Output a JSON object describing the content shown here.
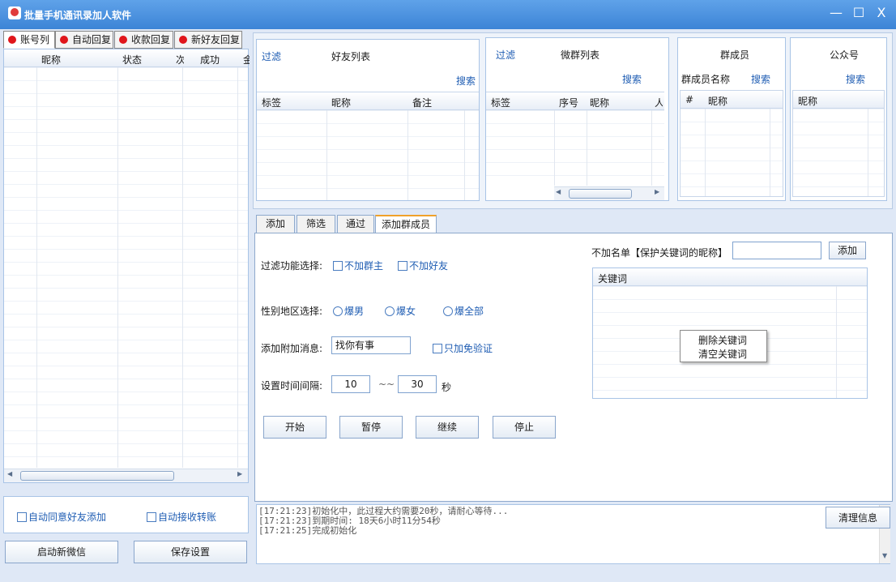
{
  "window": {
    "title": "批量手机通讯录加人软件",
    "controls": [
      "—",
      "☐",
      "X"
    ]
  },
  "left_tabs": [
    {
      "label": "账号列"
    },
    {
      "label": "自动回复"
    },
    {
      "label": "收款回复"
    },
    {
      "label": "新好友回复"
    }
  ],
  "account_table": {
    "columns": [
      "昵称",
      "状态",
      "次",
      "成功",
      "金"
    ]
  },
  "left_options": {
    "auto_accept_friend": "自动同意好友添加",
    "auto_receive_transfer": "自动接收转账"
  },
  "left_buttons": {
    "start_wechat": "启动新微信",
    "save_settings": "保存设置"
  },
  "friend_panel": {
    "filter": "过滤",
    "title": "好友列表",
    "search": "搜索",
    "columns": [
      "标签",
      "昵称",
      "备注"
    ]
  },
  "group_panel": {
    "filter": "过滤",
    "title": "微群列表",
    "search": "搜索",
    "columns": [
      "标签",
      "序号",
      "昵称",
      "人"
    ]
  },
  "member_panel": {
    "title": "群成员",
    "name_label": "群成员名称",
    "search": "搜索",
    "columns": [
      "#",
      "昵称"
    ]
  },
  "official_panel": {
    "title": "公众号",
    "search": "搜索",
    "columns": [
      "昵称"
    ]
  },
  "sub_tabs": [
    {
      "label": "添加"
    },
    {
      "label": "筛选"
    },
    {
      "label": "通过"
    },
    {
      "label": "添加群成员"
    }
  ],
  "form": {
    "filter_label": "过滤功能选择:",
    "no_group_owner": "不加群主",
    "no_friend": "不加好友",
    "gender_label": "性别地区选择:",
    "male": "爆男",
    "female": "爆女",
    "all": "爆全部",
    "message_label": "添加附加消息:",
    "message_value": "找你有事",
    "no_verify": "只加免验证",
    "interval_label": "设置时间间隔:",
    "interval_min": "10",
    "interval_sep": "~~",
    "interval_max": "30",
    "interval_unit": "秒"
  },
  "blacklist": {
    "label": "不加名单【保护关键词的昵称】",
    "add_button": "添加",
    "column": "关键词"
  },
  "context_menu": {
    "delete": "删除关键词",
    "clear": "清空关键词"
  },
  "actions": {
    "start": "开始",
    "pause": "暂停",
    "resume": "继续",
    "stop": "停止"
  },
  "log": {
    "lines": [
      "[17:21:23]初始化中，此过程大约需要20秒，请耐心等待...",
      "[17:21:23]到期时间: 18天6小时11分54秒",
      "[17:21:25]完成初始化"
    ],
    "clear_button": "清理信息"
  }
}
